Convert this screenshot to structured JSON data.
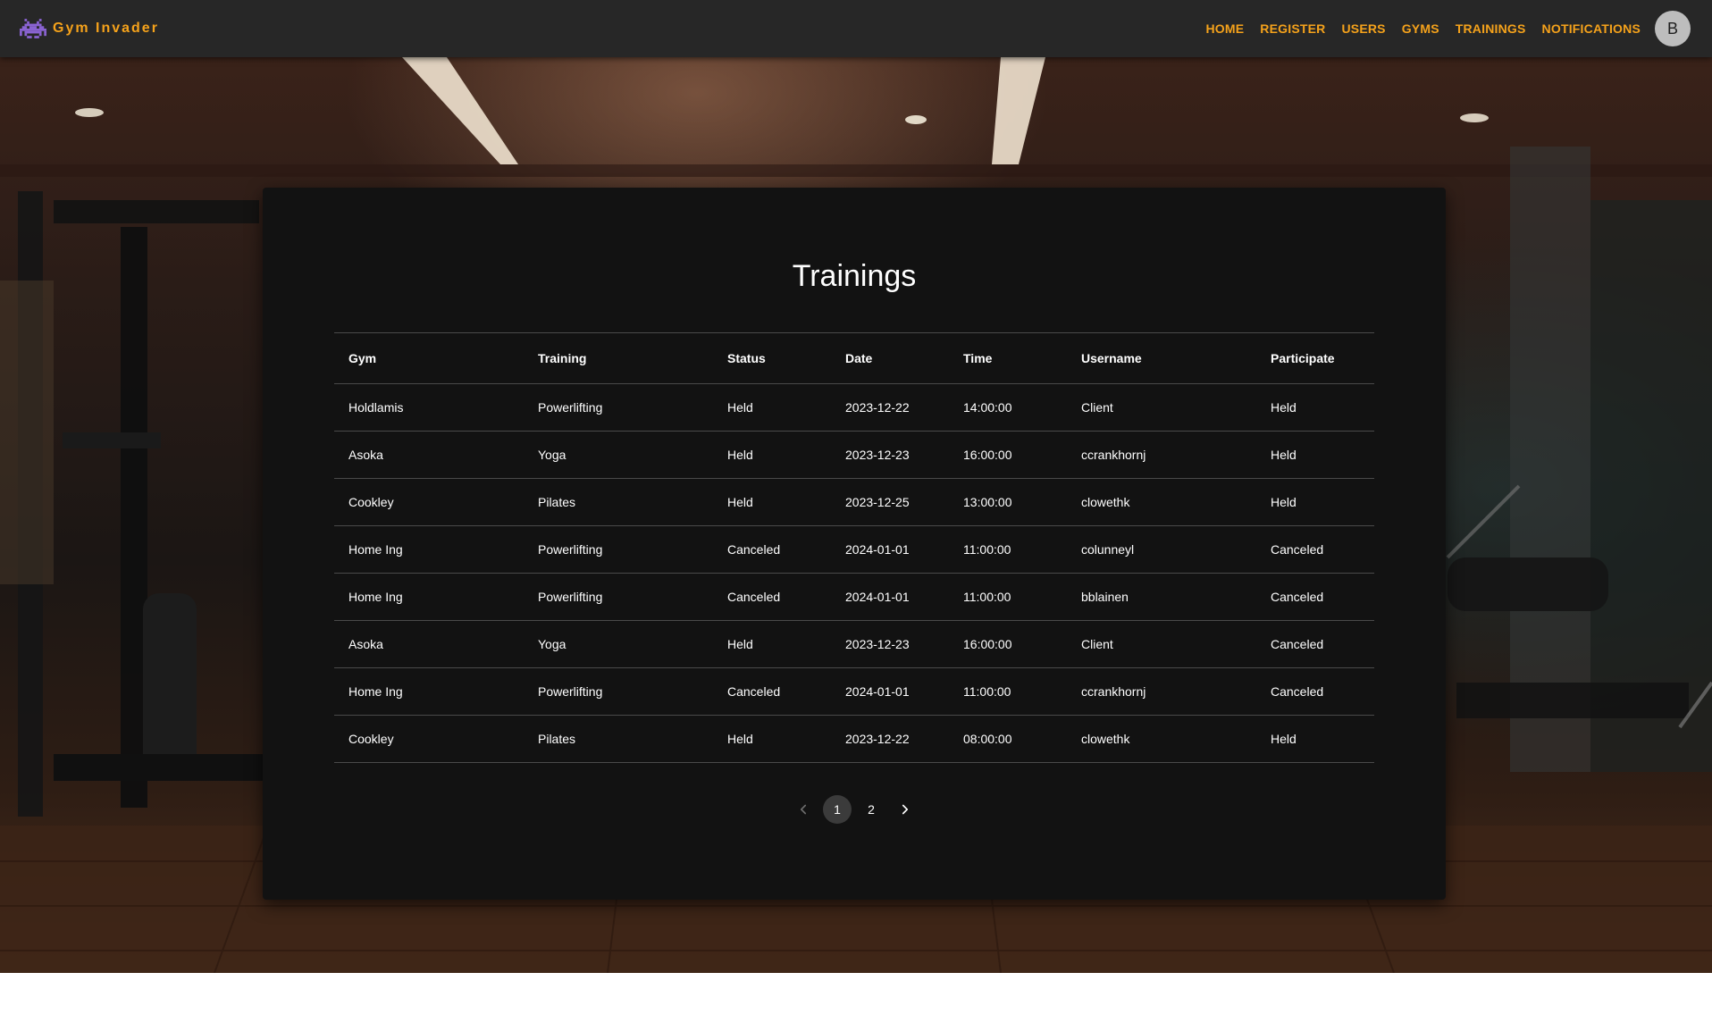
{
  "navbar": {
    "brand": "Gym Invader",
    "links": [
      "HOME",
      "REGISTER",
      "USERS",
      "GYMS",
      "TRAININGS",
      "NOTIFICATIONS"
    ],
    "avatar_initial": "B"
  },
  "main": {
    "title": "Trainings",
    "table": {
      "columns": [
        "Gym",
        "Training",
        "Status",
        "Date",
        "Time",
        "Username",
        "Participate"
      ],
      "rows": [
        [
          "Holdlamis",
          "Powerlifting",
          "Held",
          "2023-12-22",
          "14:00:00",
          "Client",
          "Held"
        ],
        [
          "Asoka",
          "Yoga",
          "Held",
          "2023-12-23",
          "16:00:00",
          "ccrankhornj",
          "Held"
        ],
        [
          "Cookley",
          "Pilates",
          "Held",
          "2023-12-25",
          "13:00:00",
          "clowethk",
          "Held"
        ],
        [
          "Home Ing",
          "Powerlifting",
          "Canceled",
          "2024-01-01",
          "11:00:00",
          "colunneyl",
          "Canceled"
        ],
        [
          "Home Ing",
          "Powerlifting",
          "Canceled",
          "2024-01-01",
          "11:00:00",
          "bblainen",
          "Canceled"
        ],
        [
          "Asoka",
          "Yoga",
          "Held",
          "2023-12-23",
          "16:00:00",
          "Client",
          "Canceled"
        ],
        [
          "Home Ing",
          "Powerlifting",
          "Canceled",
          "2024-01-01",
          "11:00:00",
          "ccrankhornj",
          "Canceled"
        ],
        [
          "Cookley",
          "Pilates",
          "Held",
          "2023-12-22",
          "08:00:00",
          "clowethk",
          "Held"
        ]
      ]
    },
    "pagination": {
      "pages": [
        "1",
        "2"
      ],
      "current": "1",
      "prev_icon": "chevron-left-icon",
      "next_icon": "chevron-right-icon"
    }
  },
  "colors": {
    "accent": "#f5a21b",
    "navbar_bg": "#272727",
    "card_bg": "#121212",
    "avatar_bg": "#bdbdbd"
  }
}
